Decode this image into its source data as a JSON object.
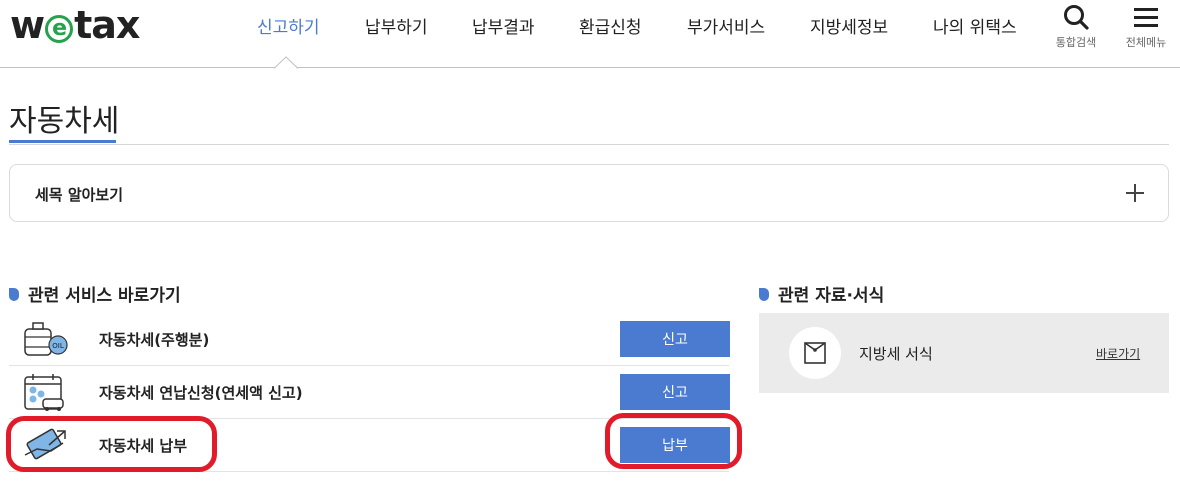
{
  "header": {
    "logo": {
      "pre": "w",
      "mid": "e",
      "post": "tax"
    },
    "nav": [
      "신고하기",
      "납부하기",
      "납부결과",
      "환급신청",
      "부가서비스",
      "지방세정보",
      "나의 위택스"
    ],
    "active_index": 0,
    "search_label": "통합검색",
    "menu_label": "전체메뉴"
  },
  "page": {
    "title": "자동차세"
  },
  "accordion": {
    "label": "세목 알아보기",
    "icon": "plus-icon"
  },
  "related_services": {
    "heading": "관련 서비스 바로가기",
    "rows": [
      {
        "label": "자동차세(주행분)",
        "button": "신고",
        "icon": "fuel-tank-icon"
      },
      {
        "label": "자동차세 연납신청(연세액 신고)",
        "button": "신고",
        "icon": "calendar-car-icon"
      },
      {
        "label": "자동차세 납부",
        "button": "납부",
        "icon": "card-payment-icon"
      }
    ]
  },
  "related_docs": {
    "heading": "관련 자료·서식",
    "item_label": "지방세 서식",
    "link": "바로가기",
    "icon": "envelope-icon"
  },
  "colors": {
    "accent": "#4a7bd0",
    "highlight": "#e11b2a",
    "logo_green": "#25a24c",
    "panel_bg": "#ebebeb"
  }
}
